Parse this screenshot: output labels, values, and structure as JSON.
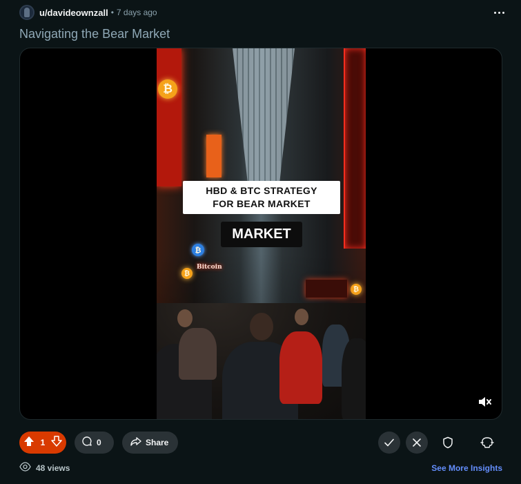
{
  "post": {
    "username": "u/davideownzall",
    "separator": "•",
    "time_ago": "7 days ago",
    "title": "Navigating the Bear Market"
  },
  "video": {
    "caption_line1": "HBD & BTC STRATEGY",
    "caption_line2": "FOR BEAR MARKET",
    "caption_box2": "MARKET",
    "sign_text": "Bitcoin",
    "muted": true
  },
  "actions": {
    "upvotes": "1",
    "comments": "0",
    "share_label": "Share"
  },
  "footer": {
    "views": "48 views",
    "insights_label": "See More Insights"
  },
  "colors": {
    "upvote_active": "#d93a00",
    "link": "#648efc",
    "background": "#0b1416"
  }
}
